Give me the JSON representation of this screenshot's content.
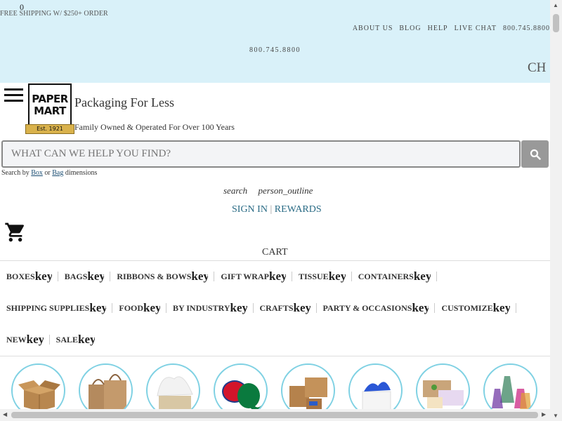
{
  "banner": {
    "cart_count": "0",
    "free_shipping": "FREE SHIPPING W/ $250+ ORDER",
    "links": [
      "ABOUT US",
      "BLOG",
      "HELP",
      "LIVE CHAT",
      "800.745.8800"
    ],
    "phone": "800.745.8800",
    "truncated": "CH"
  },
  "header": {
    "logo_line1": "PAPER",
    "logo_line2": "MART",
    "logo_est": "Est. 1921",
    "tagline": "Packaging For Less",
    "subtagline": "Family Owned & Operated For Over 100 Years"
  },
  "search": {
    "placeholder": "WHAT CAN WE HELP YOU FIND?",
    "search_by_prefix": "Search by",
    "box_link": "Box",
    "or": "or",
    "bag_link": "Bag",
    "suffix": "dimensions"
  },
  "account": {
    "search_icon_text": "search",
    "person_icon_text": "person_outline",
    "sign_in": "SIGN IN",
    "separator": "|",
    "rewards": "REWARDS",
    "cart": "CART"
  },
  "nav": {
    "key_text": "key",
    "row1": [
      "BOXES",
      "BAGS",
      "RIBBONS & BOWS",
      "GIFT WRAP",
      "TISSUE",
      "CONTAINERS"
    ],
    "row2": [
      "SHIPPING SUPPLIES",
      "FOOD",
      "BY INDUSTRY",
      "CRAFTS",
      "PARTY & OCCASIONS",
      "CUSTOMIZE"
    ],
    "row3": [
      "NEW",
      "SALE"
    ]
  },
  "colors": {
    "banner_bg": "#d9f1f9",
    "accent_link": "#2a6b85",
    "circle_border": "#7fd1e3"
  }
}
